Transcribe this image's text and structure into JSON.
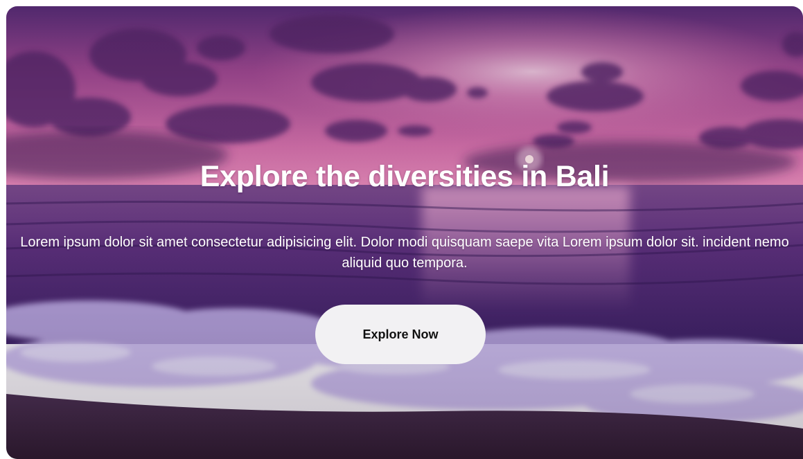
{
  "hero": {
    "title": "Explore the diversities in Bali",
    "text": "Lorem ipsum dolor sit amet consectetur adipisicing elit. Dolor modi quisquam saepe vita Lorem ipsum dolor sit. incident nemo aliquid quo tempora.",
    "button_label": "Explore Now",
    "colors": {
      "sky_top": "#5b2a78",
      "sky_glow": "#f0a2cf",
      "sea": "#6c3a8a",
      "foam": "#d6c9f5",
      "sand": "#3a2435",
      "button_bg": "#f2f1f3",
      "text": "#ffffff"
    }
  }
}
